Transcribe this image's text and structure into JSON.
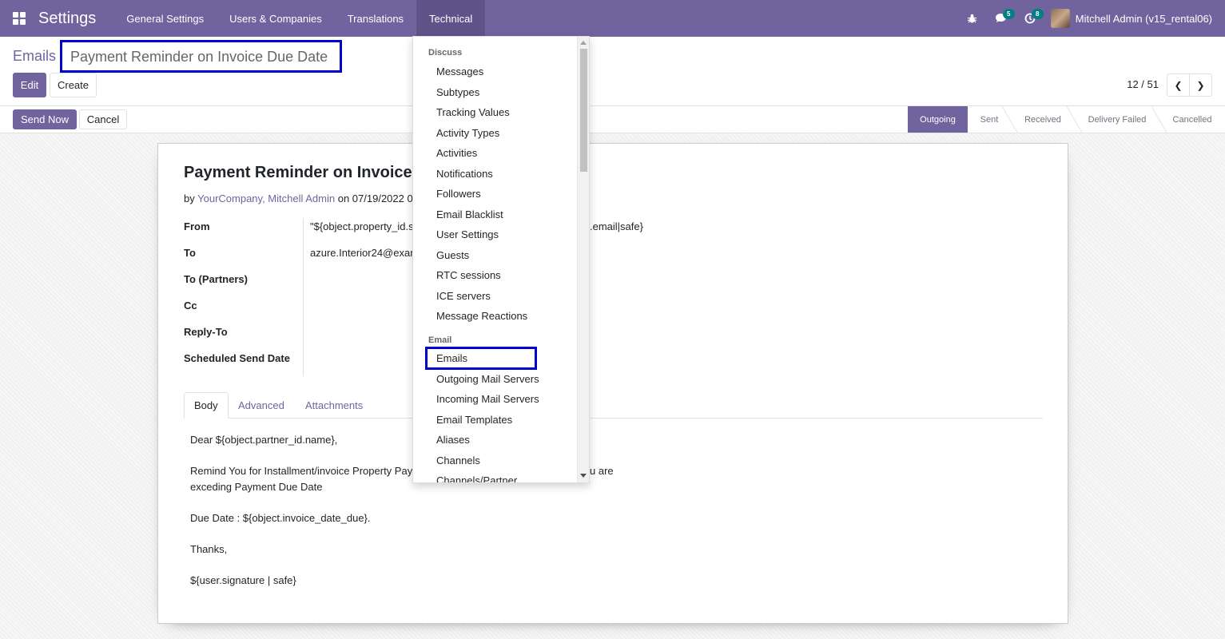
{
  "navbar": {
    "app_name": "Settings",
    "menu": [
      "General Settings",
      "Users & Companies",
      "Translations",
      "Technical"
    ],
    "messages_count": "5",
    "activities_count": "8",
    "user_name": "Mitchell Admin (v15_rental06)",
    "bg_color": "#71639e"
  },
  "breadcrumb": {
    "root": "Emails",
    "current": "Payment Reminder on Invoice Due Date"
  },
  "toolbar": {
    "edit": "Edit",
    "create": "Create",
    "send_now": "Send Now",
    "cancel": "Cancel"
  },
  "pager": {
    "value": "12 / 51"
  },
  "statusbar": {
    "stages": [
      "Outgoing",
      "Sent",
      "Received",
      "Delivery Failed",
      "Cancelled"
    ],
    "current": "Outgoing"
  },
  "mail": {
    "title": "Payment Reminder on Invoice",
    "meta_by": "by",
    "meta_authors": "YourCompany, Mitchell Admin",
    "meta_on": "on 07/19/2022 0",
    "fields": {
      "from_label": "From",
      "from_value_left": "\"${object.property_id.s",
      "from_value_right": ".email|safe}",
      "to_label": "To",
      "to_value": "azure.Interior24@exar",
      "to_partners_label": "To (Partners)",
      "cc_label": "Cc",
      "reply_to_label": "Reply-To",
      "scheduled_label": "Scheduled Send Date"
    },
    "tabs": [
      "Body",
      "Advanced",
      "Attachments"
    ],
    "body": {
      "greeting": "Dear ${object.partner_id.name},",
      "line1_left": "Remind You for Installment/invoice Property Pay",
      "line1_right": "u are",
      "line2": "exceding Payment Due Date",
      "due_date": "Due Date : ${object.invoice_date_due}.",
      "thanks": "Thanks,",
      "signature": "${user.signature | safe}"
    }
  },
  "dropdown": {
    "discuss_header": "Discuss",
    "discuss_items": [
      "Messages",
      "Subtypes",
      "Tracking Values",
      "Activity Types",
      "Activities",
      "Notifications",
      "Followers",
      "Email Blacklist",
      "User Settings",
      "Guests",
      "RTC sessions",
      "ICE servers",
      "Message Reactions"
    ],
    "email_header": "Email",
    "email_items": [
      "Emails",
      "Outgoing Mail Servers",
      "Incoming Mail Servers",
      "Email Templates",
      "Aliases",
      "Channels",
      "Channels/Partner"
    ],
    "highlighted": "Emails"
  }
}
